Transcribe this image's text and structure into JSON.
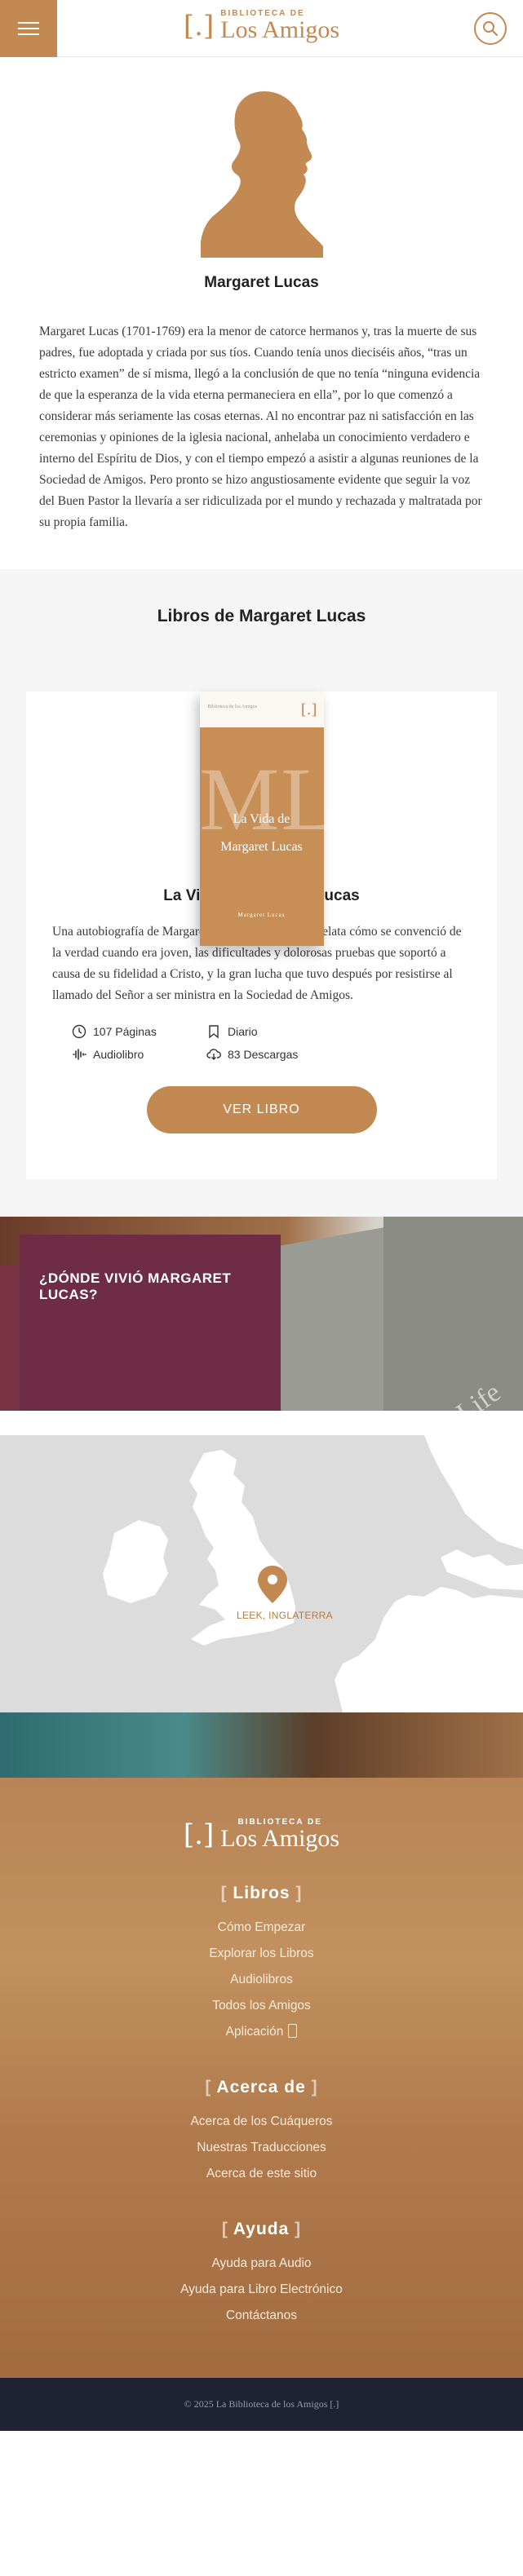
{
  "header": {
    "logo_small": "BIBLIOTECA DE",
    "logo_big": "Los Amigos",
    "logo_bracket": "[.]"
  },
  "author": {
    "name": "Margaret Lucas",
    "bio": "Margaret Lucas (1701-1769) era la menor de catorce hermanos y, tras la muerte de sus padres, fue adoptada y criada por sus tíos. Cuando tenía unos dieciséis años, “tras un estricto examen” de sí misma, llegó a la conclusión de que no tenía “ninguna evidencia de que la esperanza de la vida eterna permaneciera en ella”, por lo que comenzó a considerar más seriamente las cosas eternas. Al no encontrar paz ni satisfacción en las ceremonias y opiniones de la iglesia nacional, anhelaba un conocimiento verdadero e interno del Espíritu de Dios, y con el tiempo empezó a asistir a algunas reuniones de la Sociedad de Amigos. Pero pronto se hizo angustiosamente evidente que seguir la voz del Buen Pastor la llevaría a ser ridiculizada por el mundo y rechazada y maltratada por su propia familia."
  },
  "books": {
    "section_title": "Libros de Margaret Lucas",
    "items": [
      {
        "cover_header": "Biblioteca de los Amigos",
        "cover_logo": "[.]",
        "cover_initials": "ML",
        "cover_title_line1": "La Vida de",
        "cover_title_line2": "Margaret Lucas",
        "cover_author": "Margaret Lucas",
        "title": "La Vida de Margaret Lucas",
        "description": "Una autobiografía de Margaret Lucas, en la que ella relata cómo se convenció de la verdad cuando era joven, las dificultades y dolorosas pruebas que soportó a causa de su fidelidad a Cristo, y la gran lucha que tuvo después por resistirse al llamado del Señor a ser ministra en la Sociedad de Amigos.",
        "pages": "107 Páginas",
        "genre": "Diario",
        "audio": "Audiolibro",
        "downloads": "83 Descargas",
        "cta": "VER LIBRO"
      }
    ]
  },
  "where": {
    "title": "¿DÓNDE VIVIÓ MARGARET LUCAS?",
    "book_spine_text": "The Life"
  },
  "map": {
    "location": "LEEK, INGLATERRA"
  },
  "footer": {
    "logo_small": "BIBLIOTECA DE",
    "logo_big": "Los Amigos",
    "logo_bracket": "[.]",
    "sections": [
      {
        "title": "Libros",
        "links": [
          "Cómo Empezar",
          "Explorar los Libros",
          "Audiolibros",
          "Todos los Amigos",
          "Aplicación"
        ]
      },
      {
        "title": "Acerca de",
        "links": [
          "Acerca de los Cuáqueros",
          "Nuestras Traducciones",
          "Acerca de este sitio"
        ]
      },
      {
        "title": "Ayuda",
        "links": [
          "Ayuda para Audio",
          "Ayuda para Libro Electrónico",
          "Contáctanos"
        ]
      }
    ],
    "copyright": "© 2025 La Biblioteca de los Amigos [.]"
  },
  "colors": {
    "accent": "#c28a52",
    "where_box": "#6e2d44",
    "bottom_bar": "#1f2233"
  }
}
